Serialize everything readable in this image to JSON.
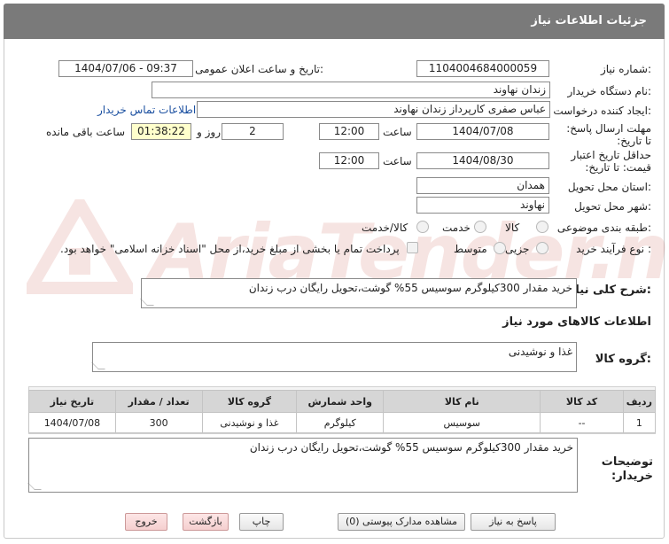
{
  "header": {
    "title": "جزئیات اطلاعات نیاز"
  },
  "watermark": {
    "text": "AriaTender.neT"
  },
  "fields": {
    "need_number_label": "شماره نیاز:",
    "need_number": "1104004684000059",
    "announce_label": "تاریخ و ساعت اعلان عمومی:",
    "announce_value": "1404/07/06 - 09:37",
    "buyer_org_label": "نام دستگاه خریدار:",
    "buyer_org": "زندان نهاوند",
    "creator_label": "ایجاد کننده درخواست:",
    "creator": "عباس صفری کارپرداز زندان نهاوند",
    "contact_link": "اطلاعات تماس خریدار",
    "reply_deadline_label": "مهلت ارسال پاسخ: تا تاریخ:",
    "reply_date": "1404/07/08",
    "time_label": "ساعت",
    "reply_time": "12:00",
    "days_value": "2",
    "days_label": "روز و",
    "remaining_time": "01:38:22",
    "remaining_label": "ساعت باقی مانده",
    "validity_label": "حداقل تاریخ اعتبار قیمت: تا تاریخ:",
    "validity_date": "1404/08/30",
    "validity_time_label": "ساعت",
    "validity_time": "12:00",
    "province_label": "استان محل تحویل:",
    "province": "همدان",
    "city_label": "شهر محل تحویل:",
    "city": "نهاوند",
    "category_label": "طبقه بندی موضوعی:",
    "category_options": [
      "کالا",
      "خدمت",
      "کالا/خدمت"
    ],
    "process_label": "نوع فرآیند خرید :",
    "process_options": [
      "جزیی",
      "متوسط"
    ],
    "payment_note": "پرداخت تمام یا بخشی از مبلغ خرید،از محل \"اسناد خزانه اسلامی\" خواهد بود."
  },
  "summary": {
    "label": "شرح کلی نیاز:",
    "text": "خرید مقدار 300کیلوگرم سوسیس 55% گوشت،تحویل رایگان درب زندان"
  },
  "goods_info_title": "اطلاعات کالاهای مورد نیاز",
  "goods_group": {
    "label": "گروه کالا:",
    "value": "غذا و نوشیدنی"
  },
  "table": {
    "headers": [
      "ردیف",
      "کد کالا",
      "نام کالا",
      "واحد شمارش",
      "گروه کالا",
      "تعداد / مقدار",
      "تاریخ نیاز"
    ],
    "rows": [
      [
        "1",
        "--",
        "سوسیس",
        "کیلوگرم",
        "غذا و نوشیدنی",
        "300",
        "1404/07/08"
      ]
    ]
  },
  "buyer_notes": {
    "label": "توضیحات خریدار:",
    "text": "خرید مقدار 300کیلوگرم سوسیس 55% گوشت،تحویل رایگان درب زندان"
  },
  "buttons": {
    "reply": "پاسخ به نیاز",
    "view_docs": "مشاهده مدارک پیوستی (0)",
    "print": "چاپ",
    "back": "بازگشت",
    "exit": "خروج"
  }
}
